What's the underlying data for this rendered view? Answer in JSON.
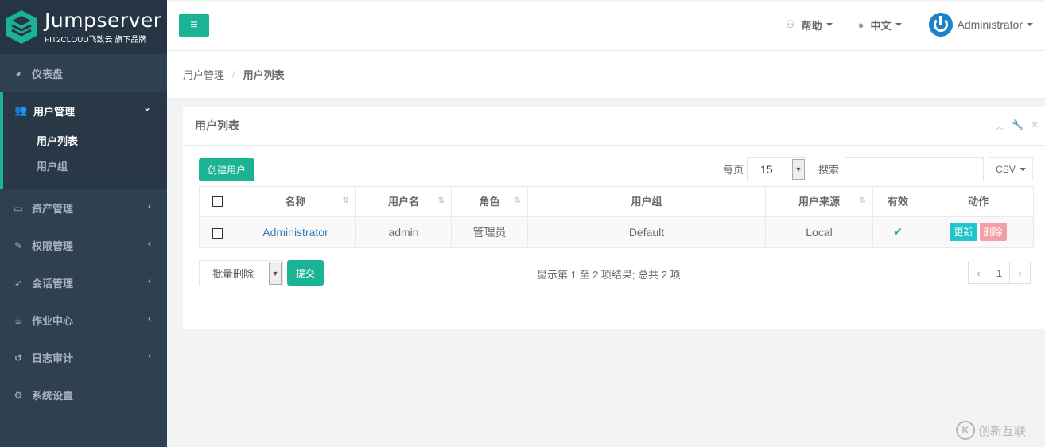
{
  "brand": {
    "name": "Jumpserver",
    "tagline": "FIT2CLOUD飞致云 旗下品牌"
  },
  "sidebar": {
    "items": [
      {
        "label": "仪表盘",
        "icon": "dashboard-icon"
      },
      {
        "label": "用户管理",
        "icon": "users-icon",
        "active": true,
        "children": [
          {
            "label": "用户列表",
            "active": true
          },
          {
            "label": "用户组"
          }
        ]
      },
      {
        "label": "资产管理",
        "icon": "inbox-icon"
      },
      {
        "label": "权限管理",
        "icon": "edit-icon"
      },
      {
        "label": "会话管理",
        "icon": "rocket-icon"
      },
      {
        "label": "作业中心",
        "icon": "coffee-icon"
      },
      {
        "label": "日志审计",
        "icon": "history-icon"
      },
      {
        "label": "系统设置",
        "icon": "cogs-icon"
      }
    ]
  },
  "header": {
    "menu_icon": "≡",
    "help": "帮助",
    "language": "中文",
    "user": "Administrator"
  },
  "breadcrumb": {
    "parent": "用户管理",
    "current": "用户列表"
  },
  "panel": {
    "title": "用户列表",
    "create_button": "创建用户",
    "per_page_label": "每页",
    "per_page_value": "15",
    "search_label": "搜索",
    "search_value": "",
    "export_button": "CSV",
    "columns": [
      "名称",
      "用户名",
      "角色",
      "用户组",
      "用户来源",
      "有效",
      "动作"
    ],
    "rows": [
      {
        "name": "Administrator",
        "username": "admin",
        "role": "管理员",
        "group": "Default",
        "source": "Local",
        "valid": "✔",
        "update": "更新",
        "delete": "删除"
      }
    ],
    "bulk_action": "批量删除",
    "submit_button": "提交",
    "info": "显示第 1 至 2 项结果; 总共 2 项",
    "pager": {
      "prev": "‹",
      "page": "1",
      "next": "›"
    }
  },
  "watermark": "创新互联",
  "colors": {
    "sidebar": "#2f4050",
    "accent": "#1ab394",
    "link": "#337ab7",
    "info": "#23c6c8",
    "danger": "#f1a0a8"
  }
}
